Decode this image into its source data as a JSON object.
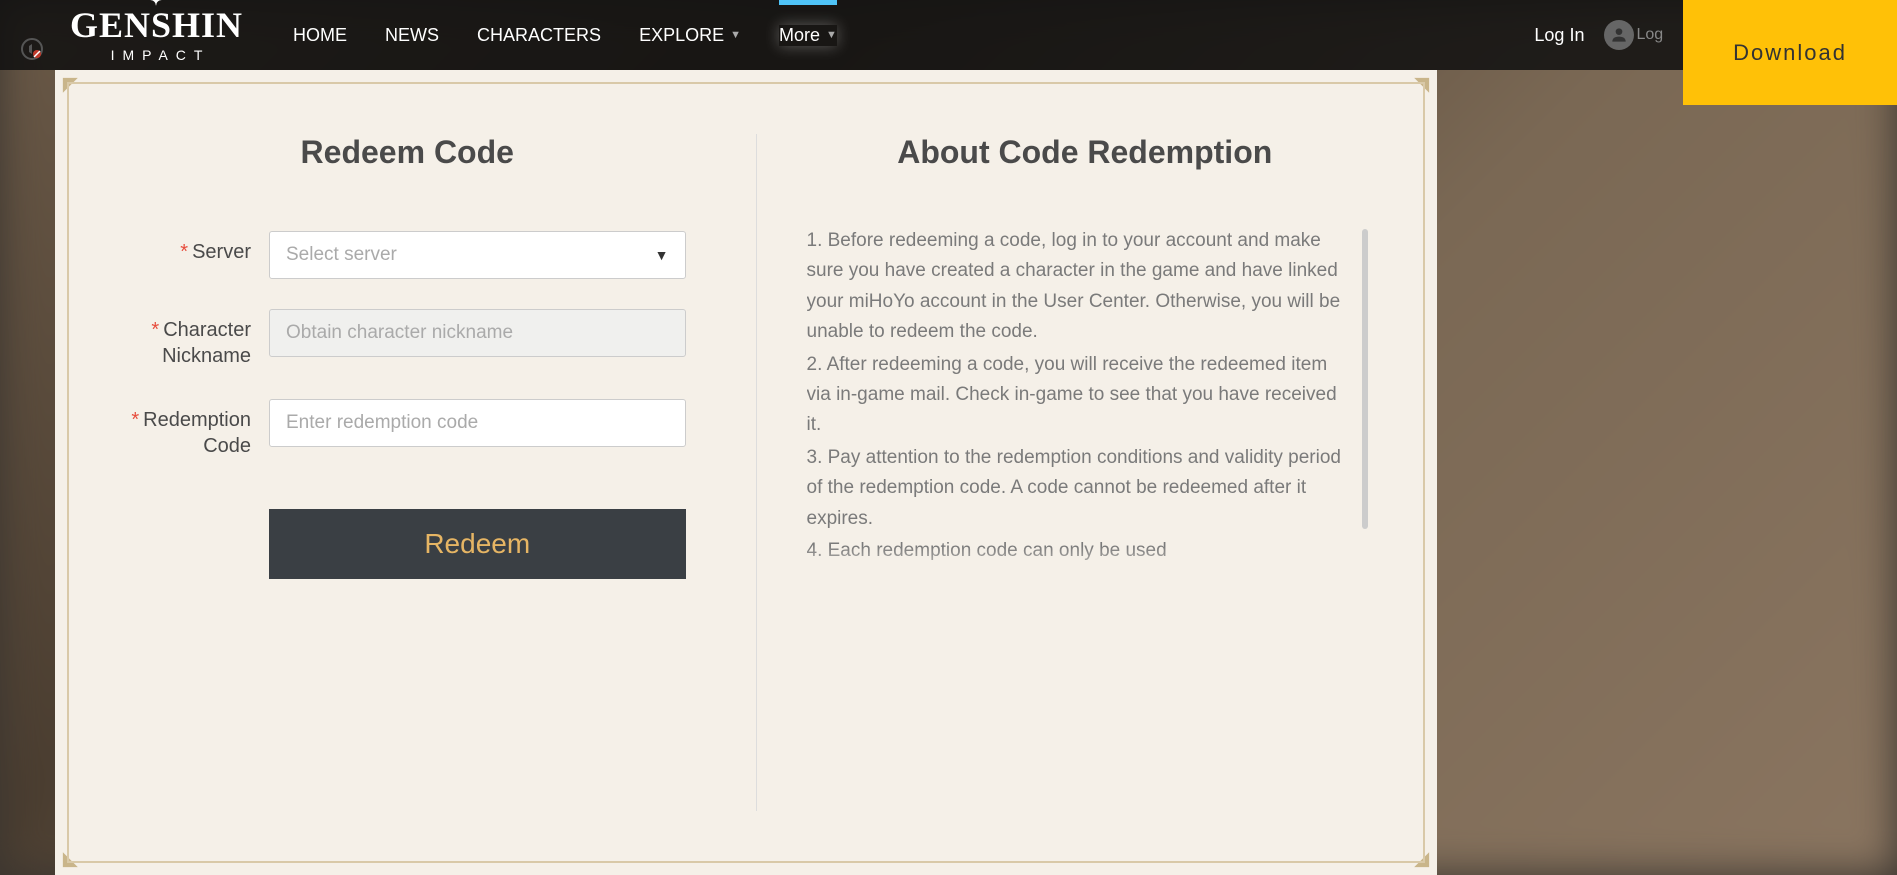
{
  "nav": {
    "logo_main": "GENSHIN",
    "logo_sub": "IMPACT",
    "links": [
      "HOME",
      "NEWS",
      "CHARACTERS",
      "EXPLORE",
      "More"
    ],
    "login": "Log In",
    "avatar_text": "Log",
    "download": "Download"
  },
  "form": {
    "title": "Redeem Code",
    "server_label": "Server",
    "server_placeholder": "Select server",
    "nickname_label": "Character Nickname",
    "nickname_placeholder": "Obtain character nickname",
    "code_label": "Redemption Code",
    "code_placeholder": "Enter redemption code",
    "submit": "Redeem"
  },
  "info": {
    "title": "About Code Redemption",
    "item1": "1. Before redeeming a code, log in to your account and make sure you have created a character in the game and have linked your miHoYo account in the User Center. Otherwise, you will be unable to redeem the code.",
    "item2": "2. After redeeming a code, you will receive the redeemed item via in-game mail. Check in-game to see that you have received it.",
    "item3": "3. Pay attention to the redemption conditions and validity period of the redemption code. A code cannot be redeemed after it expires.",
    "item4": "4. Each redemption code can only be used"
  }
}
